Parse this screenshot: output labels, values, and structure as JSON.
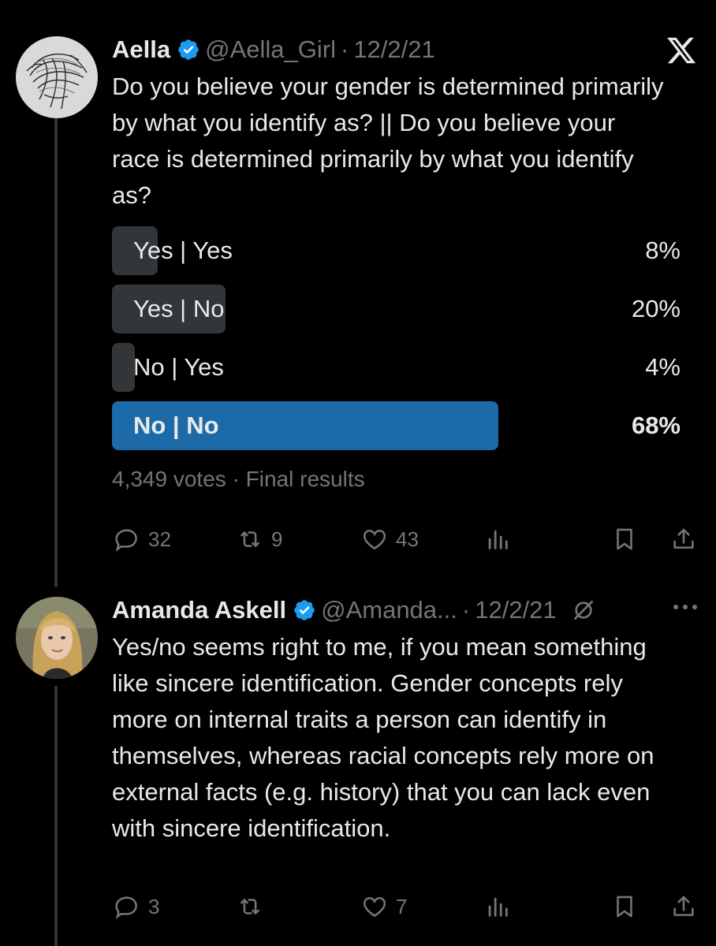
{
  "tweets": [
    {
      "display_name": "Aella",
      "handle": "@Aella_Girl",
      "dot": "·",
      "date": "12/2/21",
      "text": "Do you believe your gender is determined primarily by what you identify as? || Do you believe your race is determined primarily by what you identify as?",
      "avatar_icon": "sketch-portrait-avatar",
      "poll": {
        "options": [
          {
            "label": "Yes | Yes",
            "percent_text": "8%",
            "fraction": 0.08,
            "winner": false
          },
          {
            "label": "Yes | No",
            "percent_text": "20%",
            "fraction": 0.2,
            "winner": false
          },
          {
            "label": "No | Yes",
            "percent_text": "4%",
            "fraction": 0.04,
            "winner": false
          },
          {
            "label": "No | No",
            "percent_text": "68%",
            "fraction": 0.68,
            "winner": true
          }
        ],
        "votes": "4,349 votes",
        "status": "Final results"
      },
      "actions": {
        "replies": "32",
        "reposts": "9",
        "likes": "43"
      }
    },
    {
      "display_name": "Amanda Askell",
      "handle": "@Amanda...",
      "dot": "·",
      "date": "12/2/21",
      "text": "Yes/no seems right to me, if you mean something like sincere identification. Gender concepts rely more on internal traits a person can identify in themselves, whereas racial concepts rely more on external facts (e.g. history) that you can lack even with sincere identification.",
      "avatar_icon": "photo-avatar",
      "actions": {
        "replies": "3",
        "reposts": "",
        "likes": "7"
      }
    }
  ],
  "colors": {
    "background": "#000000",
    "text": "#e7e9ea",
    "muted": "#71767b",
    "poll_bar": "#333639",
    "poll_winner": "#1d6aa8",
    "verified": "#1d9bf0"
  },
  "icons": [
    "x-logo-icon",
    "verified-badge-icon",
    "reply-icon",
    "repost-icon",
    "like-icon",
    "views-icon",
    "bookmark-icon",
    "share-icon",
    "grok-slash-icon",
    "more-icon"
  ]
}
